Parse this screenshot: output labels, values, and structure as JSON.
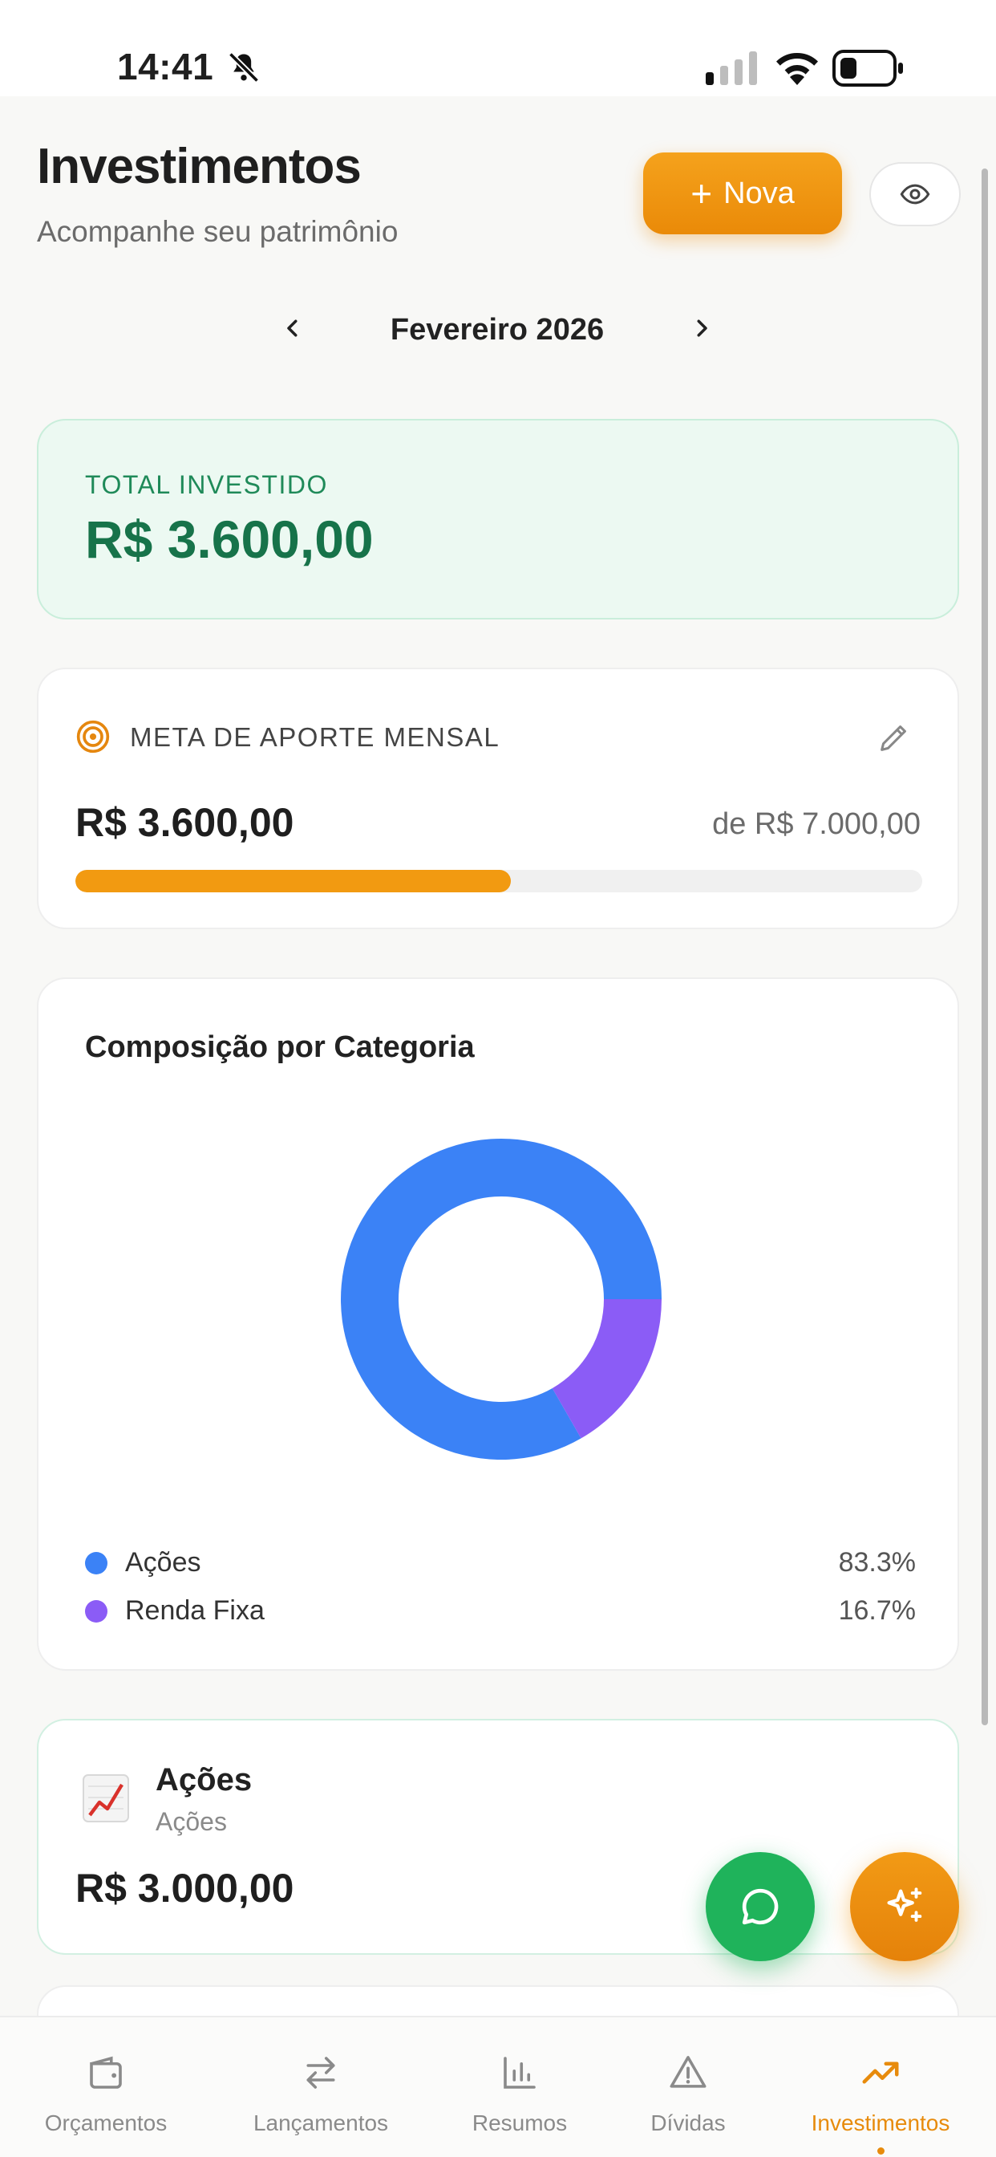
{
  "status_bar": {
    "time": "14:41",
    "icons": [
      "bell-slash-icon",
      "signal-icon",
      "wifi-icon",
      "battery-icon"
    ]
  },
  "header": {
    "title": "Investimentos",
    "subtitle": "Acompanhe seu patrimônio",
    "new_button_label": "Nova",
    "new_button_icon": "plus-icon",
    "visibility_icon": "eye-icon"
  },
  "month_nav": {
    "label": "Fevereiro 2026",
    "prev_icon": "chevron-left-icon",
    "next_icon": "chevron-right-icon"
  },
  "total": {
    "label": "TOTAL INVESTIDO",
    "value": "R$ 3.600,00"
  },
  "monthly_goal": {
    "title": "META DE APORTE MENSAL",
    "current": "R$ 3.600,00",
    "goal": "de R$ 7.000,00",
    "progress_fraction": 0.514,
    "icon": "target-icon",
    "edit_icon": "pencil-icon"
  },
  "composition": {
    "title": "Composição por Categoria",
    "chart_data": {
      "type": "pie",
      "donut": true,
      "categories": [
        "Ações",
        "Renda Fixa"
      ],
      "values": [
        83.3,
        16.7
      ],
      "colors": [
        "#3b82f6",
        "#8b5cf6"
      ],
      "value_labels": [
        "83.3%",
        "16.7%"
      ]
    }
  },
  "category_cards": [
    {
      "title": "Ações",
      "subtitle": "Ações",
      "value": "R$ 3.000,00",
      "icon": "chart-increasing-icon"
    }
  ],
  "fabs": {
    "chat_icon": "chat-bubble-icon",
    "ai_icon": "sparkles-icon"
  },
  "tabs": [
    {
      "label": "Orçamentos",
      "icon": "wallet-icon",
      "active": false
    },
    {
      "label": "Lançamentos",
      "icon": "arrows-exchange-icon",
      "active": false
    },
    {
      "label": "Resumos",
      "icon": "bar-chart-icon",
      "active": false
    },
    {
      "label": "Dívidas",
      "icon": "warning-triangle-icon",
      "active": false
    },
    {
      "label": "Investimentos",
      "icon": "trending-up-icon",
      "active": true
    }
  ],
  "colors": {
    "accent": "#f29a11",
    "success": "#17734a",
    "background": "#f8f8f6"
  }
}
